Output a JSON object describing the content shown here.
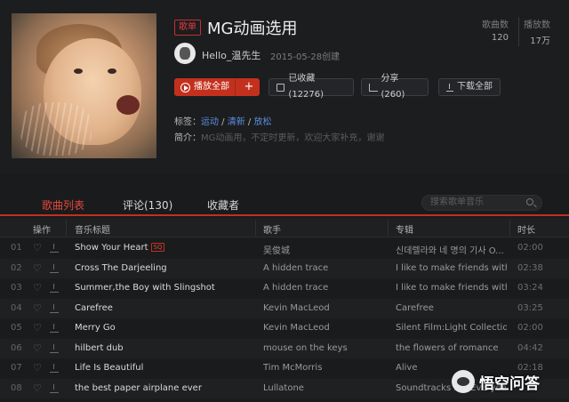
{
  "playlist": {
    "badge": "歌单",
    "title": "MG动画选用",
    "stats": {
      "songs_label": "歌曲数",
      "songs_value": "120",
      "plays_label": "播放数",
      "plays_value": "17万"
    },
    "creator": {
      "name": "Hello_温先生",
      "created": "2015-05-28创建"
    },
    "actions": {
      "play_all": "播放全部",
      "add": "+",
      "favorite": "已收藏(12276)",
      "share": "分享(260)",
      "download_all": "下载全部"
    },
    "tags_label": "标签：",
    "tags": [
      "运动",
      "清新",
      "放松"
    ],
    "tag_separator": " / ",
    "desc_label": "简介：",
    "description": "MG动画用，不定时更新，欢迎大家补充，谢谢"
  },
  "tabs": [
    {
      "label": "歌曲列表",
      "active": true
    },
    {
      "label": "评论(130)",
      "active": false
    },
    {
      "label": "收藏者",
      "active": false
    }
  ],
  "search": {
    "placeholder": "搜索歌单音乐"
  },
  "table": {
    "headers": {
      "ops": "操作",
      "title": "音乐标题",
      "artist": "歌手",
      "album": "专辑",
      "duration": "时长"
    },
    "sq_badge": "SQ",
    "rows": [
      {
        "idx": "01",
        "title": "Show Your Heart",
        "sq": true,
        "artist": "吴俊城",
        "album": "신데렐라와 네 명의 기사 O...",
        "duration": "02:00"
      },
      {
        "idx": "02",
        "title": "Cross The Darjeeling",
        "sq": false,
        "artist": "A hidden trace",
        "album": "I like to make friends with ...",
        "duration": "02:38"
      },
      {
        "idx": "03",
        "title": "Summer,the Boy with Slingshot",
        "sq": false,
        "artist": "A hidden trace",
        "album": "I like to make friends with ...",
        "duration": "03:24"
      },
      {
        "idx": "04",
        "title": "Carefree",
        "sq": false,
        "artist": "Kevin MacLeod",
        "album": "Carefree",
        "duration": "03:25"
      },
      {
        "idx": "05",
        "title": "Merry Go",
        "sq": false,
        "artist": "Kevin MacLeod",
        "album": "Silent Film:Light Collection",
        "duration": "02:00"
      },
      {
        "idx": "06",
        "title": "hilbert dub",
        "sq": false,
        "artist": "mouse on the keys",
        "album": "the flowers of romance",
        "duration": "04:42"
      },
      {
        "idx": "07",
        "title": "Life Is Beautiful",
        "sq": false,
        "artist": "Tim McMorris",
        "album": "Alive",
        "duration": "02:18"
      },
      {
        "idx": "08",
        "title": "the best paper airplane ever",
        "sq": false,
        "artist": "Lullatone",
        "album": "Soundtracks For Everyday...",
        "duration": ""
      }
    ]
  },
  "watermark": {
    "text": "悟空问答"
  },
  "colors": {
    "accent": "#c3301d",
    "link": "#5a8ee0",
    "background": "#1a1b1d"
  }
}
